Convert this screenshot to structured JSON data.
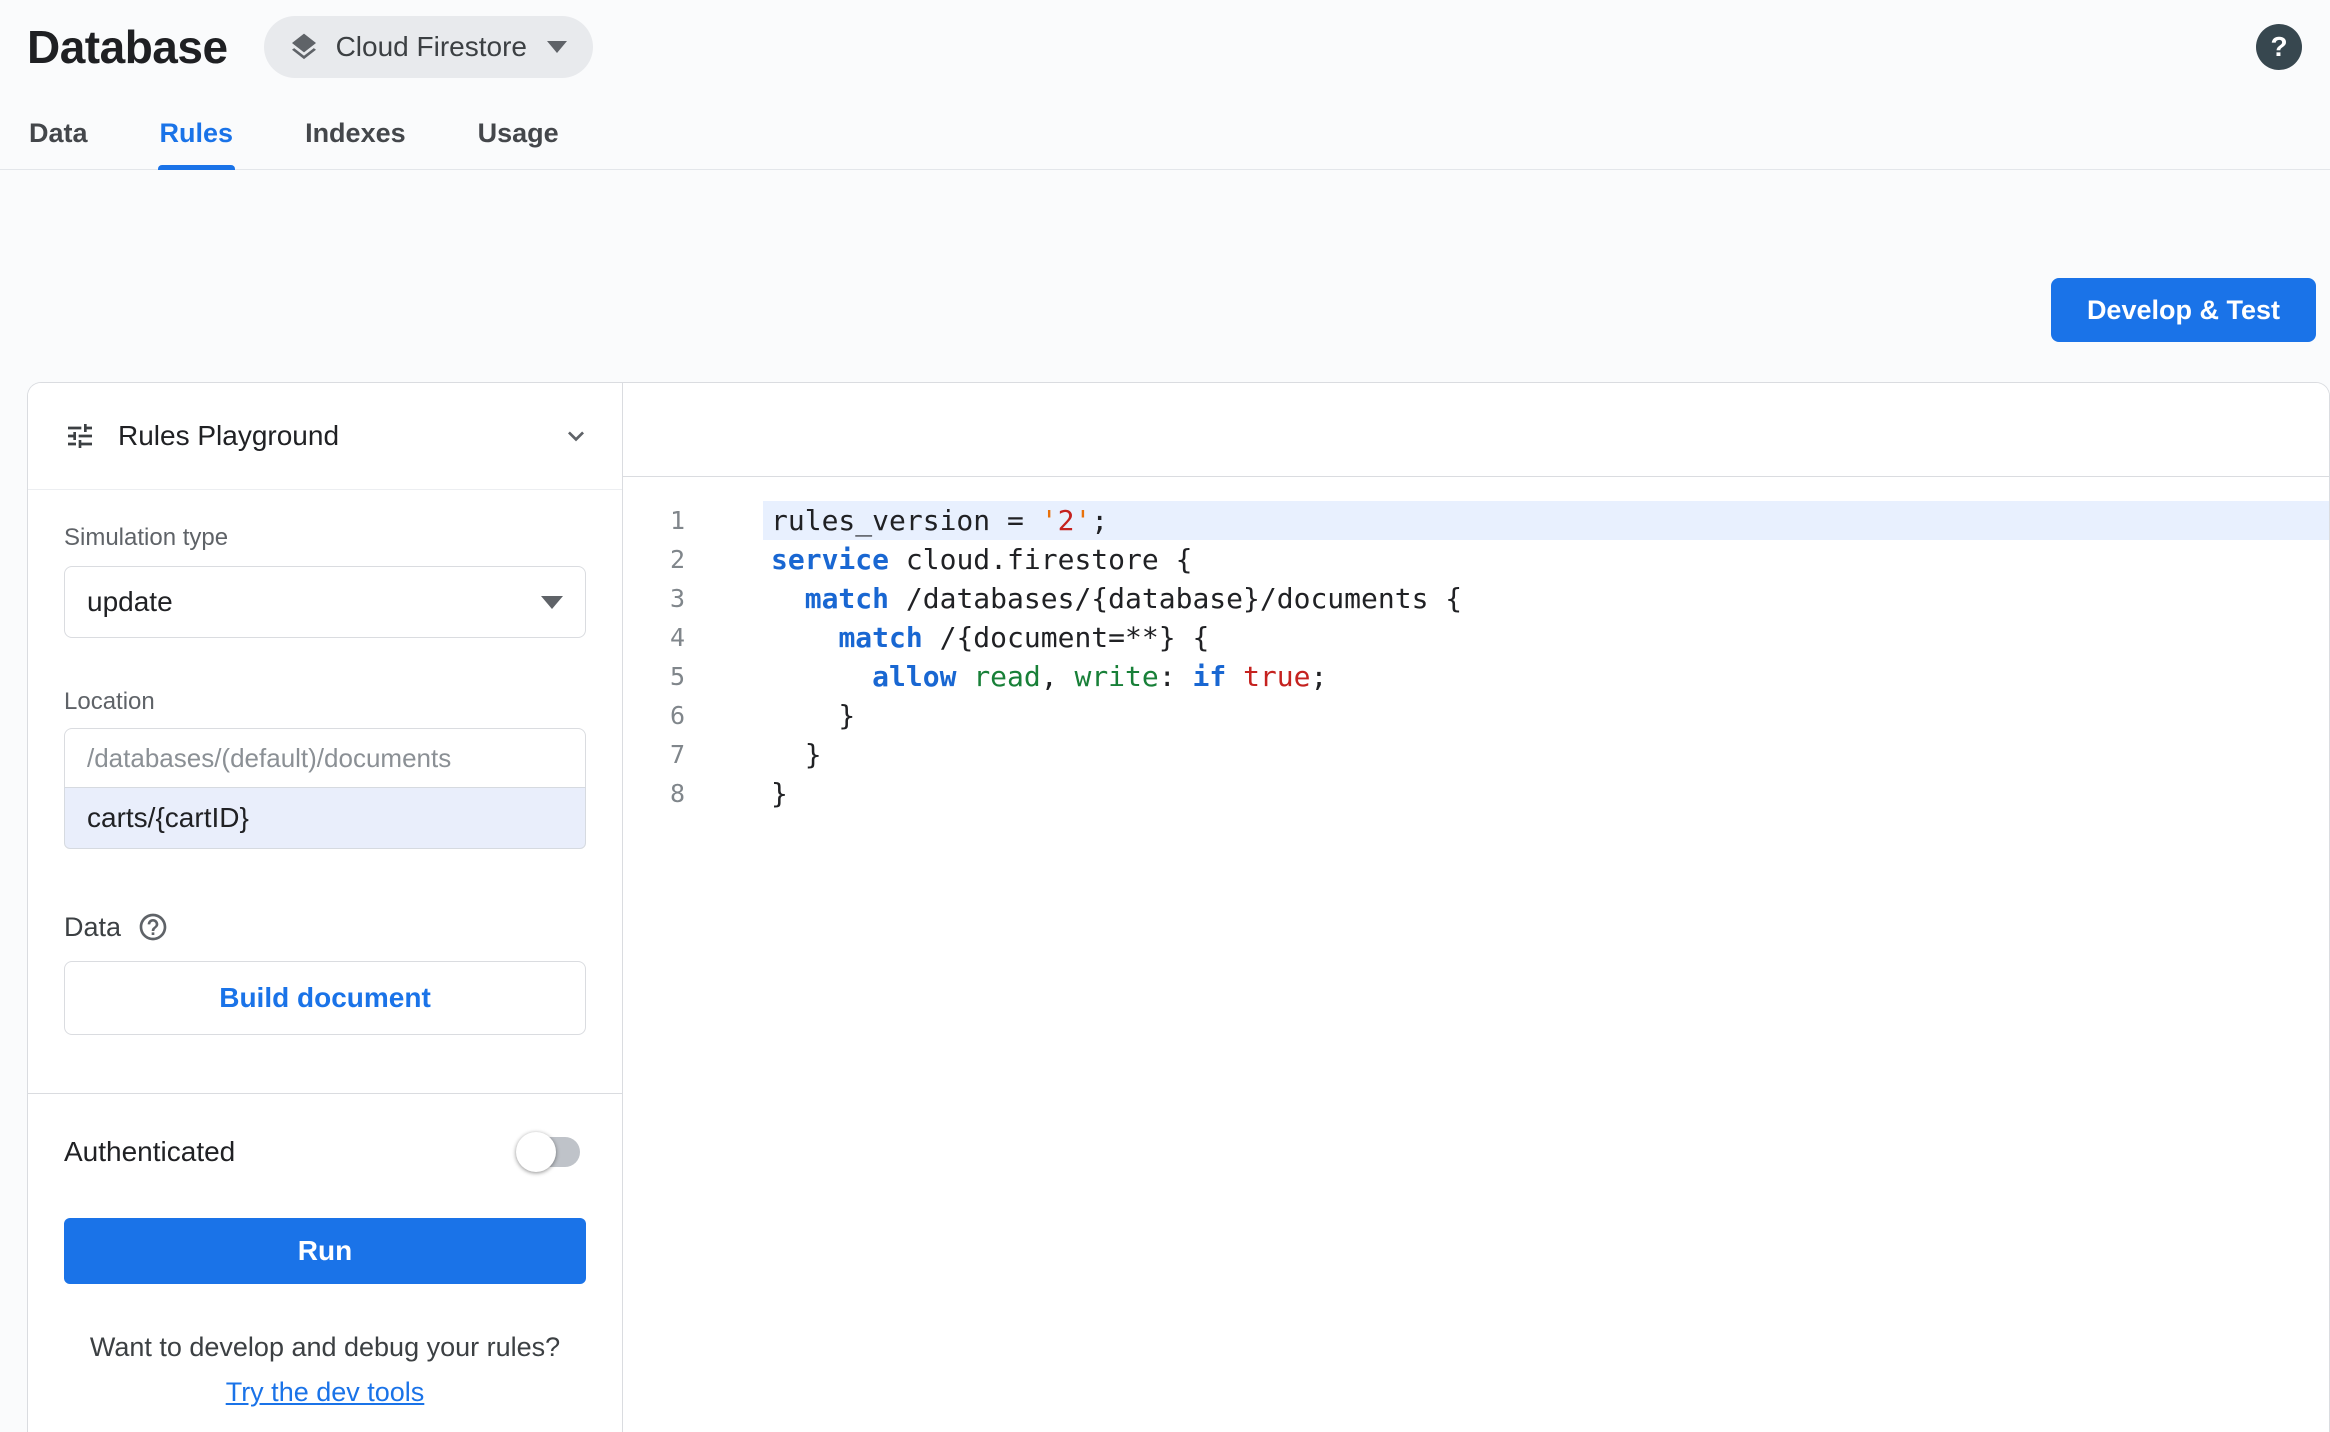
{
  "header": {
    "title": "Database",
    "product": "Cloud Firestore",
    "help": "?"
  },
  "tabs": [
    {
      "label": "Data"
    },
    {
      "label": "Rules"
    },
    {
      "label": "Indexes"
    },
    {
      "label": "Usage"
    }
  ],
  "active_tab": "Rules",
  "actions": {
    "develop_test": "Develop & Test"
  },
  "playground": {
    "title": "Rules Playground",
    "simulation_type_label": "Simulation type",
    "simulation_type_value": "update",
    "location_label": "Location",
    "location_base_path": "/databases/(default)/documents",
    "location_value": "carts/{cartID}",
    "data_label": "Data",
    "build_document_label": "Build document",
    "authenticated_label": "Authenticated",
    "authenticated_on": false,
    "run_label": "Run",
    "footer_text": "Want to develop and debug your rules?",
    "footer_link": "Try the dev tools"
  },
  "editor": {
    "active_line": 1,
    "lines": [
      {
        "num": 1,
        "tokens": [
          [
            "plain",
            "rules_version = "
          ],
          [
            "q",
            "'"
          ],
          [
            "num",
            "2"
          ],
          [
            "q",
            "'"
          ],
          [
            "plain",
            ";"
          ]
        ]
      },
      {
        "num": 2,
        "tokens": [
          [
            "kw",
            "service"
          ],
          [
            "plain",
            " cloud.firestore {"
          ]
        ]
      },
      {
        "num": 3,
        "tokens": [
          [
            "plain",
            "  "
          ],
          [
            "kw",
            "match"
          ],
          [
            "plain",
            " /databases/{database}/documents {"
          ]
        ]
      },
      {
        "num": 4,
        "tokens": [
          [
            "plain",
            "    "
          ],
          [
            "kw",
            "match"
          ],
          [
            "plain",
            " /{document=**} {"
          ]
        ]
      },
      {
        "num": 5,
        "tokens": [
          [
            "plain",
            "      "
          ],
          [
            "kw",
            "allow"
          ],
          [
            "plain",
            " "
          ],
          [
            "fn",
            "read"
          ],
          [
            "plain",
            ", "
          ],
          [
            "fn",
            "write"
          ],
          [
            "plain",
            ": "
          ],
          [
            "kw",
            "if"
          ],
          [
            "plain",
            " "
          ],
          [
            "bool",
            "true"
          ],
          [
            "plain",
            ";"
          ]
        ]
      },
      {
        "num": 6,
        "tokens": [
          [
            "plain",
            "    }"
          ]
        ]
      },
      {
        "num": 7,
        "tokens": [
          [
            "plain",
            "  }"
          ]
        ]
      },
      {
        "num": 8,
        "tokens": [
          [
            "plain",
            "}"
          ]
        ]
      }
    ]
  },
  "colors": {
    "accent": "#1a73e8",
    "keyword": "#1967d2",
    "method": "#188038",
    "literal": "#c5221f",
    "active_line_bg": "#e8f0fe"
  }
}
